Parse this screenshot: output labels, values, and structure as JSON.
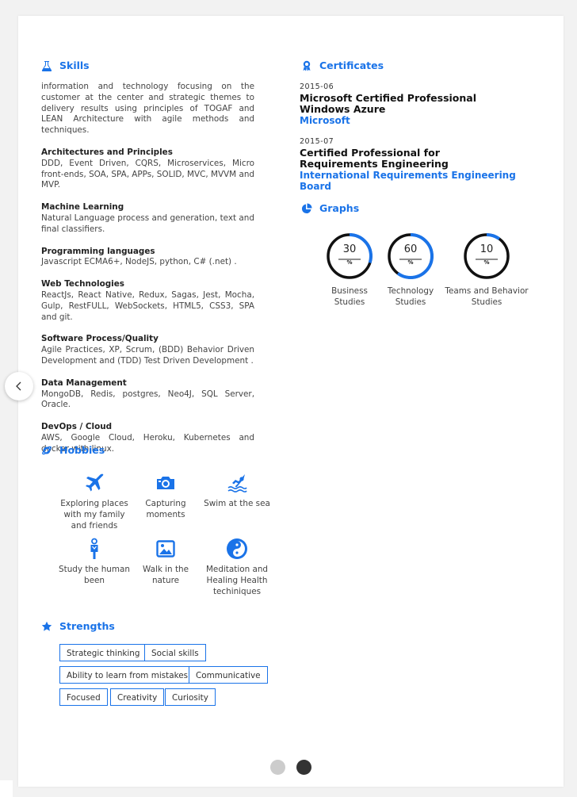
{
  "skills": {
    "heading": "Skills",
    "intro": "information and technology focusing on the customer at the center and strategic themes to delivery results using principles of TOGAF and LEAN Architecture with agile methods and techniques.",
    "items": [
      {
        "title": "Architectures and Principles",
        "text": "DDD, Event Driven, CQRS, Microservices, Micro front-ends, SOA, SPA, APPs, SOLID, MVC, MVVM and MVP."
      },
      {
        "title": "Machine Learning",
        "text": "Natural Language process and generation, text and final classifiers."
      },
      {
        "title": "Programming languages",
        "text": "Javascript ECMA6+, NodeJS, python, C# (.net) ."
      },
      {
        "title": "Web Technologies",
        "text": "ReactJs, React Native, Redux, Sagas, Jest, Mocha, Gulp, RestFULL, WebSockets, HTML5, CSS3, SPA and git."
      },
      {
        "title": "Software Process/Quality",
        "text": "Agile Practices, XP, Scrum, (BDD) Behavior Driven Development and (TDD) Test Driven Development ."
      },
      {
        "title": "Data Management",
        "text": "MongoDB, Redis, postgres, Neo4J, SQL Server, Oracle."
      },
      {
        "title": "DevOps / Cloud",
        "text": "AWS, Google Cloud, Heroku, Kubernetes and docker with linux."
      }
    ]
  },
  "certificates": {
    "heading": "Certificates",
    "items": [
      {
        "date": "2015-06",
        "name": "Microsoft Certified Professional Windows Azure",
        "issuer": "Microsoft"
      },
      {
        "date": "2015-07",
        "name": "Certified Professional for Requirements Engineering",
        "issuer": "International Requirements Engineering Board"
      }
    ]
  },
  "graphs": {
    "heading": "Graphs",
    "unit": "%",
    "items": [
      {
        "value": "30",
        "label": "Business Studies"
      },
      {
        "value": "60",
        "label": "Technology Studies"
      },
      {
        "value": "10",
        "label": "Teams and Behavior Studies"
      }
    ]
  },
  "hobbies": {
    "heading": "Hobbies",
    "items": [
      {
        "label": "Exploring places with my family and friends",
        "icon": "airplane-icon"
      },
      {
        "label": "Capturing moments",
        "icon": "camera-icon"
      },
      {
        "label": "Swim at the sea",
        "icon": "swimming-icon"
      },
      {
        "label": "Study the human been",
        "icon": "person-icon"
      },
      {
        "label": "Walk in the nature",
        "icon": "landscape-icon"
      },
      {
        "label": "Meditation and Healing Health techiniques",
        "icon": "yin-yang-icon"
      }
    ]
  },
  "strengths": {
    "heading": "Strengths",
    "tags": [
      "Strategic thinking",
      "Social skills",
      "Ability to learn from mistakes",
      "Communicative",
      "Focused",
      "Creativity",
      "Curiosity"
    ]
  },
  "colors": {
    "accent": "#1a73e8",
    "ring_track": "#111111",
    "dot_inactive": "#cccccc",
    "dot_active": "#333333"
  },
  "nav": {
    "prev_icon": "chevron-left-icon",
    "page_dots": 2,
    "active_page": 2
  }
}
